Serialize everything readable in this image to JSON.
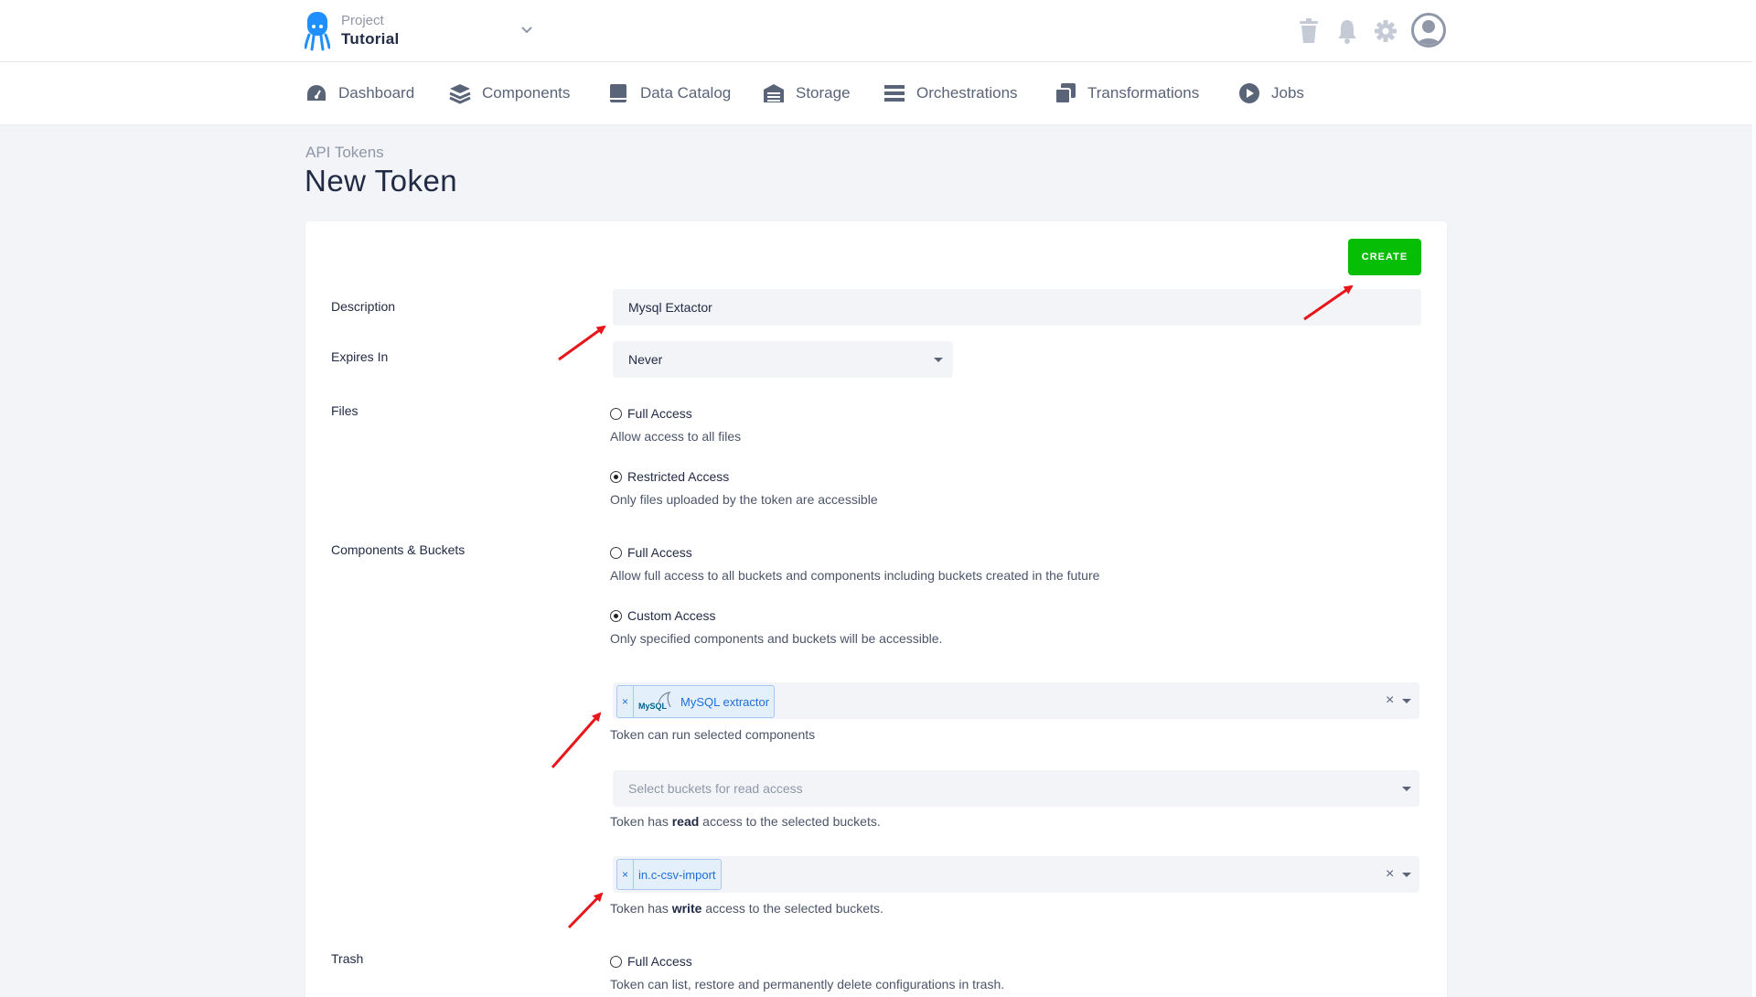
{
  "project": {
    "label": "Project",
    "name": "Tutorial"
  },
  "top_icons": [
    "trash-icon",
    "bell-icon",
    "gear-icon",
    "user-avatar"
  ],
  "nav": [
    {
      "label": "Dashboard",
      "icon": "dashboard-icon"
    },
    {
      "label": "Components",
      "icon": "layers-icon"
    },
    {
      "label": "Data Catalog",
      "icon": "book-icon"
    },
    {
      "label": "Storage",
      "icon": "warehouse-icon"
    },
    {
      "label": "Orchestrations",
      "icon": "bars-icon"
    },
    {
      "label": "Transformations",
      "icon": "copy-icon"
    },
    {
      "label": "Jobs",
      "icon": "play-icon"
    }
  ],
  "breadcrumb": "API Tokens",
  "title": "New Token",
  "create_label": "CREATE",
  "form": {
    "description": {
      "label": "Description",
      "value": "Mysql Extactor"
    },
    "expires": {
      "label": "Expires In",
      "value": "Never"
    },
    "files": {
      "label": "Files",
      "options": [
        {
          "title": "Full Access",
          "help": "Allow access to all files",
          "checked": false
        },
        {
          "title": "Restricted Access",
          "help": "Only files uploaded by the token are accessible",
          "checked": true
        }
      ]
    },
    "components": {
      "label": "Components & Buckets",
      "options": [
        {
          "title": "Full Access",
          "help": "Allow full access to all buckets and components including buckets created in the future",
          "checked": false
        },
        {
          "title": "Custom Access",
          "help": "Only specified components and buckets will be accessible.",
          "checked": true
        }
      ],
      "components_select": {
        "tag": "MySQL extractor",
        "logo": "MySQL",
        "help": "Token can run selected components"
      },
      "read_select": {
        "placeholder": "Select buckets for read access",
        "help_pre": "Token has ",
        "help_bold": "read",
        "help_post": " access to the selected buckets."
      },
      "write_select": {
        "tag": "in.c-csv-import",
        "help_pre": "Token has ",
        "help_bold": "write",
        "help_post": " access to the selected buckets."
      }
    },
    "trash": {
      "label": "Trash",
      "options": [
        {
          "title": "Full Access",
          "help": "Token can list, restore and permanently delete configurations in trash.",
          "checked": false
        }
      ]
    }
  },
  "colors": {
    "create": "#07be07",
    "annotation": "#e8161b",
    "tag_text": "#1e6fd9"
  }
}
